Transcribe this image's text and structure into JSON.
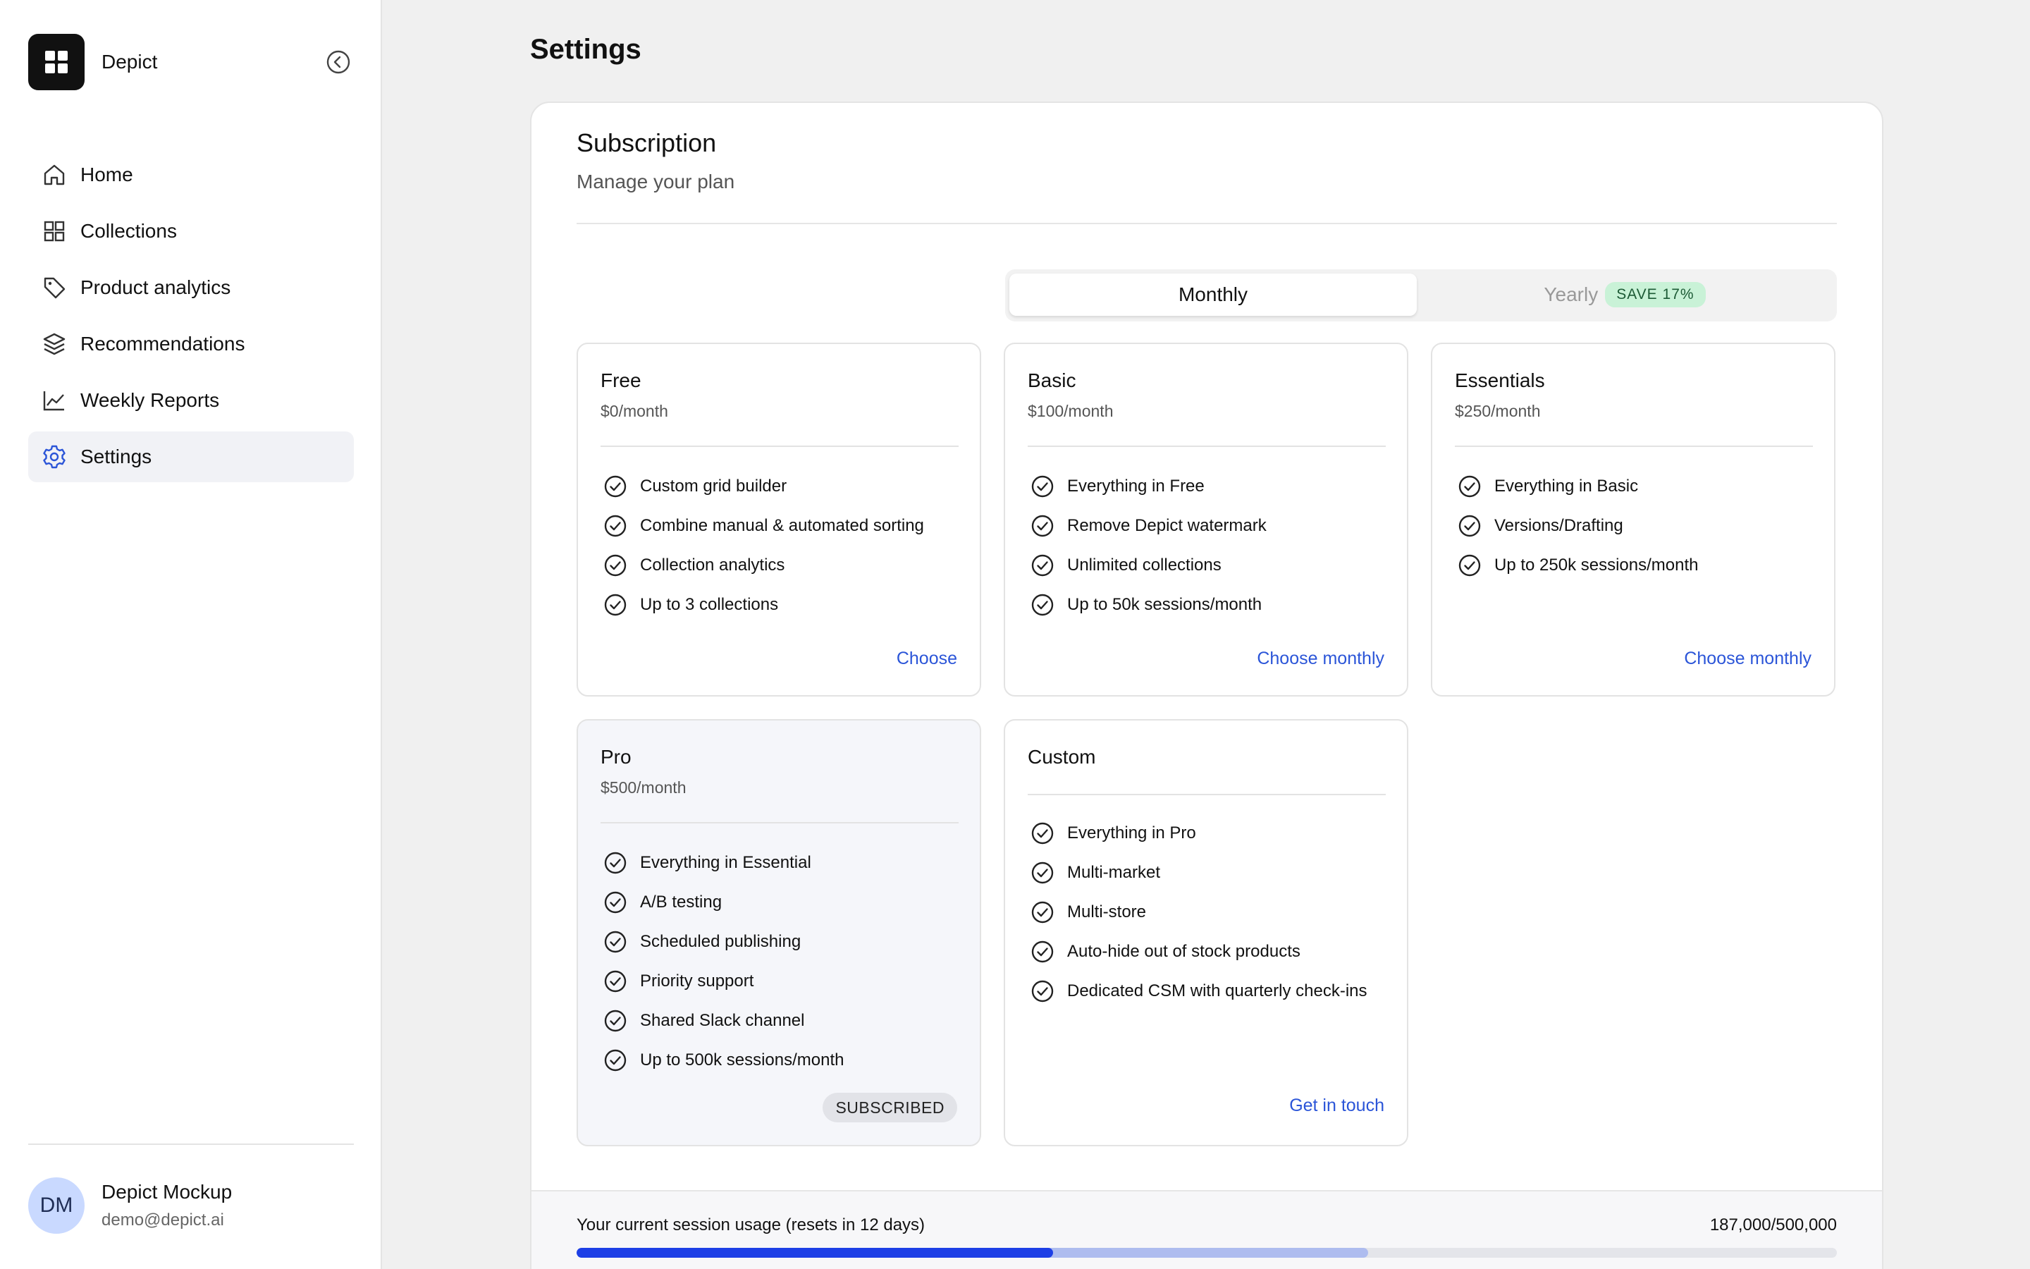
{
  "app": {
    "name": "Depict"
  },
  "sidebar": {
    "items": [
      {
        "label": "Home",
        "icon": "home-icon"
      },
      {
        "label": "Collections",
        "icon": "grid-icon"
      },
      {
        "label": "Product analytics",
        "icon": "tag-icon"
      },
      {
        "label": "Recommendations",
        "icon": "layers-icon"
      },
      {
        "label": "Weekly Reports",
        "icon": "line-chart-icon"
      },
      {
        "label": "Settings",
        "icon": "gear-icon",
        "active": true
      }
    ]
  },
  "user": {
    "initials": "DM",
    "name": "Depict Mockup",
    "email": "demo@depict.ai"
  },
  "page": {
    "title": "Settings"
  },
  "subscription": {
    "title": "Subscription",
    "description": "Manage your plan",
    "billing_toggle": {
      "monthly": "Monthly",
      "yearly": "Yearly",
      "yearly_badge": "SAVE 17%",
      "selected": "Monthly"
    },
    "plans": [
      {
        "name": "Free",
        "price": "$0/month",
        "features": [
          "Custom grid builder",
          "Combine manual & automated sorting",
          "Collection analytics",
          "Up to 3 collections"
        ],
        "action": "Choose"
      },
      {
        "name": "Basic",
        "price": "$100/month",
        "features": [
          "Everything in Free",
          "Remove Depict watermark",
          "Unlimited collections",
          "Up to 50k sessions/month"
        ],
        "action": "Choose monthly"
      },
      {
        "name": "Essentials",
        "price": "$250/month",
        "features": [
          "Everything in Basic",
          "Versions/Drafting",
          "Up to 250k sessions/month"
        ],
        "action": "Choose monthly"
      },
      {
        "name": "Pro",
        "price": "$500/month",
        "features": [
          "Everything in Essential",
          "A/B testing",
          "Scheduled publishing",
          "Priority support",
          "Shared Slack channel",
          "Up to 500k sessions/month"
        ],
        "status": "SUBSCRIBED"
      },
      {
        "name": "Custom",
        "features": [
          "Everything in Pro",
          "Multi-market",
          "Multi-store",
          "Auto-hide out of stock products",
          "Dedicated CSM with quarterly check-ins"
        ],
        "action": "Get in touch"
      }
    ],
    "usage": {
      "label": "Your current session usage (resets in 12 days)",
      "value_text": "187,000/500,000",
      "used_fraction": 0.378,
      "projected_fraction": 0.628
    }
  },
  "colors": {
    "accent": "#1d3fe6",
    "link": "#2b55d8",
    "badge_green": "#c9f2d7"
  }
}
